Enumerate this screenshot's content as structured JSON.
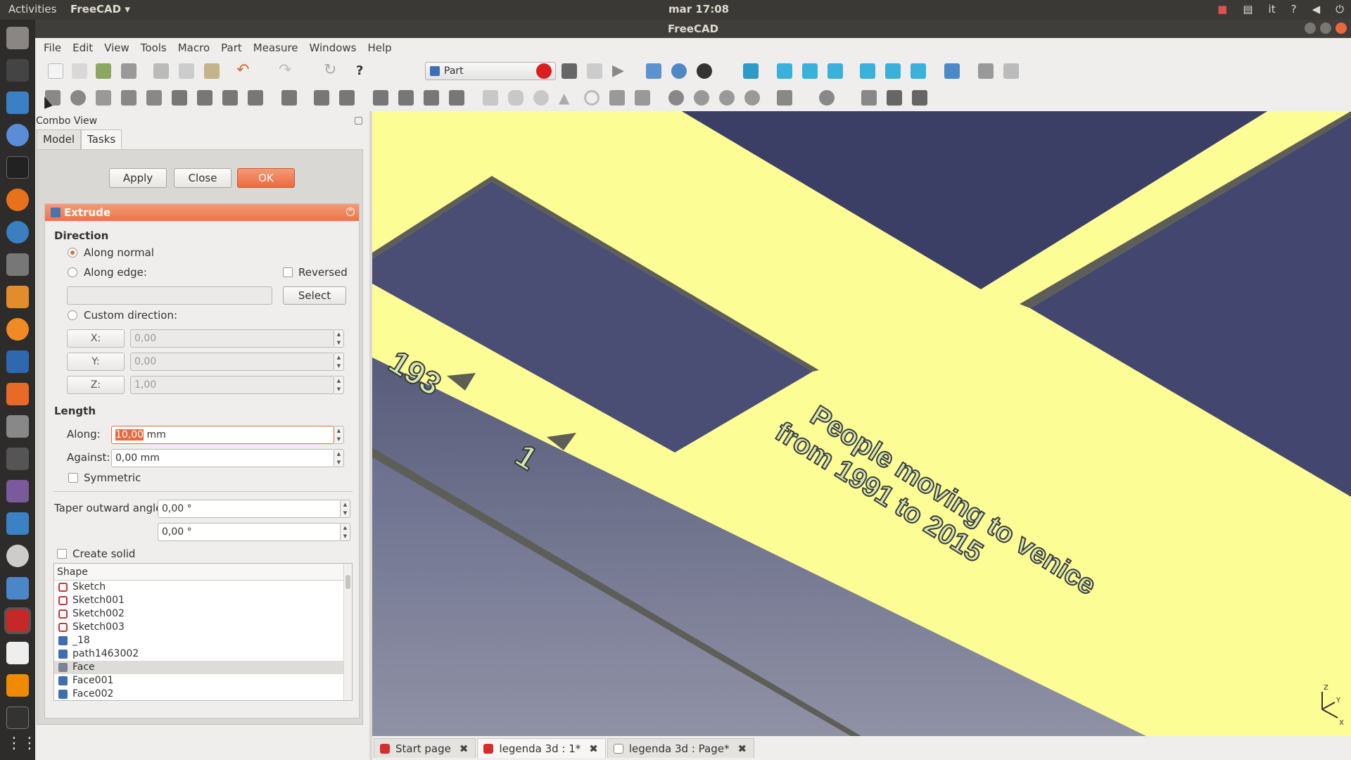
{
  "topbar": {
    "activities": "Activities",
    "app_name": "FreeCAD",
    "clock": "mar 17:08",
    "keyboard_layout": "it"
  },
  "window": {
    "title": "FreeCAD"
  },
  "menu": [
    "File",
    "Edit",
    "View",
    "Tools",
    "Macro",
    "Part",
    "Measure",
    "Windows",
    "Help"
  ],
  "workbench": {
    "selected": "Part"
  },
  "combo": {
    "title": "Combo View",
    "tabs": [
      "Model",
      "Tasks"
    ]
  },
  "task_buttons": {
    "apply": "Apply",
    "close": "Close",
    "ok": "OK"
  },
  "extrude": {
    "title": "Extrude",
    "direction_label": "Direction",
    "along_normal": "Along normal",
    "along_edge": "Along edge:",
    "reversed": "Reversed",
    "select": "Select",
    "custom_direction": "Custom direction:",
    "x_label": "X:",
    "y_label": "Y:",
    "z_label": "Z:",
    "x_value": "0,00",
    "y_value": "0,00",
    "z_value": "1,00",
    "length_label": "Length",
    "along_label": "Along:",
    "along_value_selected": "10,00",
    "along_value_unit": " mm",
    "against_label": "Against:",
    "against_value": "0,00 mm",
    "symmetric": "Symmetric",
    "taper_label": "Taper outward angle",
    "taper1": "0,00 °",
    "taper2": "0,00 °",
    "create_solid": "Create solid",
    "shape_header": "Shape",
    "shapes": [
      {
        "name": "Sketch",
        "kind": "sketch"
      },
      {
        "name": "Sketch001",
        "kind": "sketch"
      },
      {
        "name": "Sketch002",
        "kind": "sketch"
      },
      {
        "name": "Sketch003",
        "kind": "sketch"
      },
      {
        "name": "_18",
        "kind": "body"
      },
      {
        "name": "path1463002",
        "kind": "body"
      },
      {
        "name": "Face",
        "kind": "face"
      },
      {
        "name": "Face001",
        "kind": "body"
      },
      {
        "name": "Face002",
        "kind": "body"
      }
    ]
  },
  "viewport": {
    "text_line1": "People moving to venice",
    "text_line2": "from 1991 to 2015",
    "number1": "193",
    "number2": "1",
    "axis_x": "X",
    "axis_y": "Y",
    "axis_z": "Z",
    "colors": {
      "plate": "#fdfd96",
      "background_top": "#34385f",
      "background_bottom": "#8f92a5",
      "edge": "#5e5e58"
    }
  },
  "doc_tabs": [
    "Start page",
    "legenda 3d : 1*",
    "legenda 3d : Page*"
  ]
}
